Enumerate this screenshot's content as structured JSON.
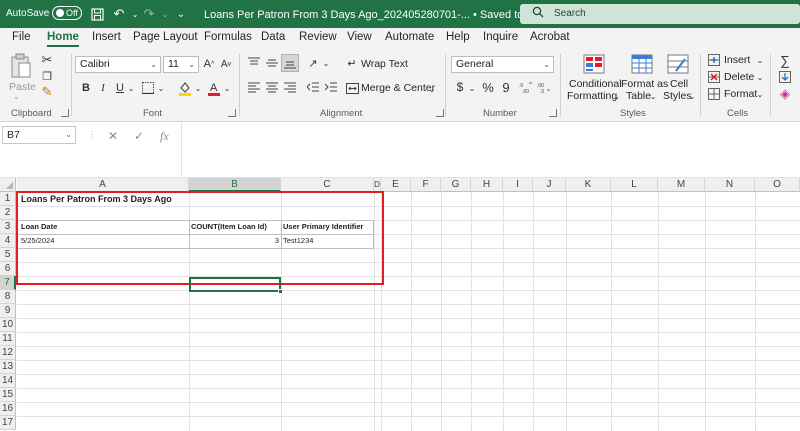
{
  "titlebar": {
    "autosave_label": "AutoSave",
    "autosave_state": "Off",
    "doc_title": "Loans Per Patron From 3 Days Ago_202405280701-...  •  Saved to this PC ⌄",
    "search_placeholder": "Search"
  },
  "menu": {
    "tabs": [
      "File",
      "Home",
      "Insert",
      "Page Layout",
      "Formulas",
      "Data",
      "Review",
      "View",
      "Automate",
      "Help",
      "Inquire",
      "Acrobat"
    ],
    "active": "Home"
  },
  "ribbon": {
    "clipboard": {
      "paste": "Paste",
      "label": "Clipboard"
    },
    "font": {
      "name": "Calibri",
      "size": "11",
      "label": "Font",
      "bold": "B",
      "italic": "I",
      "underline": "U"
    },
    "alignment": {
      "wrap_text": "Wrap Text",
      "merge_center": "Merge & Center",
      "label": "Alignment"
    },
    "number": {
      "format": "General",
      "currency": "$",
      "percent": "%",
      "comma": "9",
      "label": "Number"
    },
    "styles": {
      "conditional_line1": "Conditional",
      "conditional_line2": "Formatting",
      "format_table_line1": "Format as",
      "format_table_line2": "Table",
      "cell_styles_line1": "Cell",
      "cell_styles_line2": "Styles",
      "label": "Styles"
    },
    "cells": {
      "insert": "Insert",
      "delete": "Delete",
      "format": "Format",
      "label": "Cells"
    }
  },
  "formula_bar": {
    "name_box": "B7",
    "cancel": "✕",
    "confirm": "✓",
    "fx": "fx",
    "formula": ""
  },
  "grid": {
    "columns": [
      "A",
      "B",
      "C",
      "D",
      "E",
      "F",
      "G",
      "H",
      "I",
      "J",
      "K",
      "L",
      "M",
      "N",
      "O"
    ],
    "rows": [
      "1",
      "2",
      "3",
      "4",
      "5",
      "6",
      "7",
      "8",
      "9",
      "10",
      "11",
      "12",
      "13",
      "14",
      "15",
      "16",
      "17"
    ],
    "selected_col": "B",
    "selected_row": "7",
    "cells": {
      "A1": "Loans Per Patron From 3 Days Ago",
      "A3": "Loan Date",
      "B3": "COUNT(Item Loan Id)",
      "C3": "User Primary Identifier",
      "A4": "5/25/2024",
      "B4": "3",
      "C4": "Test1234"
    }
  },
  "colors": {
    "excel_green": "#217346",
    "highlight_red": "#e51c23"
  }
}
